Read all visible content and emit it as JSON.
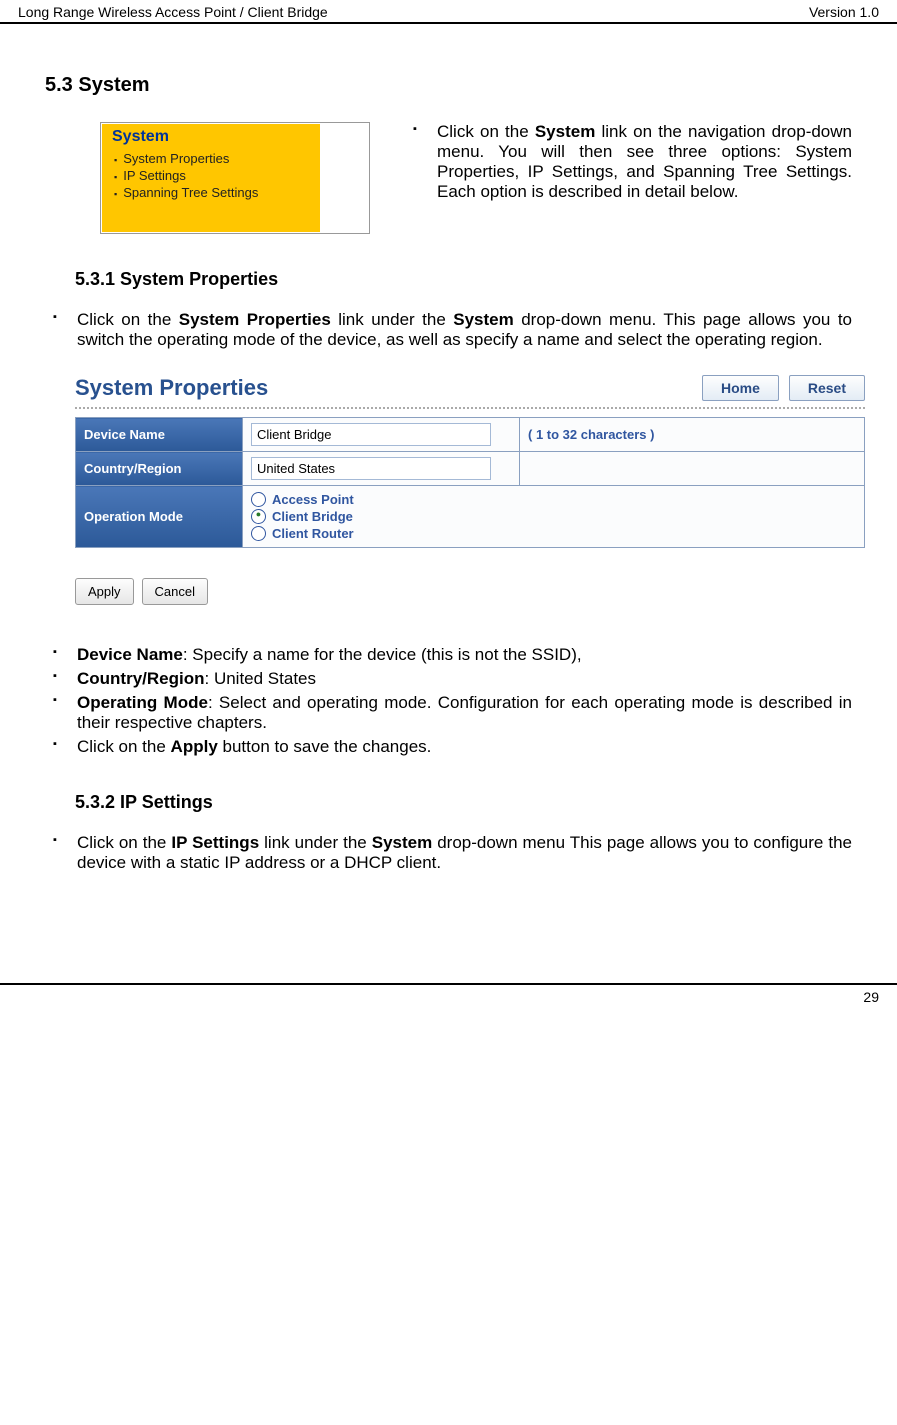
{
  "header": {
    "left": "Long Range Wireless Access Point / Client Bridge",
    "right": "Version 1.0"
  },
  "section": {
    "num_title": "5.3  System"
  },
  "nav_menu": {
    "title": "System",
    "items": [
      "System Properties",
      "IP Settings",
      "Spanning Tree Settings"
    ]
  },
  "intro_text": {
    "prefix": "Click on the ",
    "bold": "System",
    "suffix": " link on the navigation drop-down menu. You will then see three options: System Properties, IP Settings, and Spanning Tree Settings. Each option is described in detail below."
  },
  "sub1": {
    "num_title": "5.3.1   System Properties",
    "text": {
      "p1a": "Click on the ",
      "b1": "System Properties",
      "p1b": " link under the ",
      "b2": "System",
      "p1c": " drop-down menu. This page allows you to switch the operating mode of the device, as well as specify a name and select the operating region."
    }
  },
  "sys_props_ui": {
    "title": "System Properties",
    "buttons": {
      "home": "Home",
      "reset": "Reset"
    },
    "rows": {
      "device_name_label": "Device Name",
      "device_name_value": "Client Bridge",
      "device_name_hint": "( 1 to 32 characters )",
      "country_label": "Country/Region",
      "country_value": "United States",
      "opmode_label": "Operation Mode",
      "opmodes": [
        "Access Point",
        "Client Bridge",
        "Client Router"
      ],
      "selected_mode": "Client Bridge"
    },
    "footer": {
      "apply": "Apply",
      "cancel": "Cancel"
    }
  },
  "desc_bullets": {
    "b1_bold": "Device Name",
    "b1_rest": ": Specify a name for the device (this is not the SSID),",
    "b2_bold": "Country/Region",
    "b2_rest": ": United States",
    "b3_bold": "Operating Mode",
    "b3_rest": ": Select and operating mode. Configuration for each operating mode is described in their respective chapters.",
    "b4_pre": "Click on the ",
    "b4_bold": "Apply",
    "b4_post": " button to save the changes."
  },
  "sub2": {
    "num_title": "5.3.2   IP Settings",
    "text": {
      "p1a": "Click on the ",
      "b1": "IP Settings",
      "p1b": " link under the ",
      "b2": "System",
      "p1c": " drop-down menu This page allows you to configure the device with a static IP address or a DHCP client."
    }
  },
  "page_number": "29"
}
